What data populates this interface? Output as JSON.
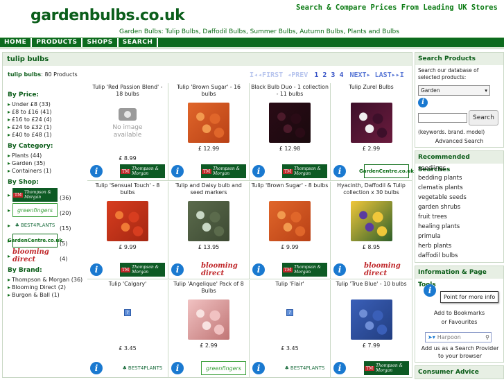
{
  "site": {
    "title": "gardenbulbs.co.uk",
    "tagline": "Search & Compare Prices From Leading UK Stores",
    "sublinks": "Garden Bulbs: Tulip Bulbs, Daffodil Bulbs, Summer Bulbs, Autumn Bulbs, Plants and Bulbs"
  },
  "nav": [
    "HOME",
    "PRODUCTS",
    "SHOPS",
    "SEARCH"
  ],
  "main": {
    "title": "tulip bulbs",
    "count_bold": "tulip bulbs",
    "count_rest": ": 80 Products"
  },
  "pager": {
    "first": "I◂◂FIRST",
    "prev": "◂PREV",
    "pages": [
      "1",
      "2",
      "3",
      "4"
    ],
    "next": "NEXT▸",
    "last": "LAST▸▸I"
  },
  "filters": {
    "price_title": "By Price:",
    "price": [
      "Under £8 (33)",
      "£8 to £16 (41)",
      "£16 to £24 (4)",
      "£24 to £32 (1)",
      "£40 to £48 (1)"
    ],
    "category_title": "By Category:",
    "category": [
      "Plants (44)",
      "Garden (35)",
      "Containers (1)"
    ],
    "shop_title": "By Shop:",
    "shops": [
      {
        "logo": "Thompson & Morgan",
        "count": "(36)"
      },
      {
        "logo": "greenfingers",
        "count": "(20)"
      },
      {
        "logo": "BEST4PLANTS",
        "count": "(15)"
      },
      {
        "logo": "GardenCentre.co.uk",
        "count": "(5)"
      },
      {
        "logo": "blooming direct",
        "count": "(4)"
      }
    ],
    "brand_title": "By Brand:",
    "brand": [
      "Thompson & Morgan (36)",
      "Blooming Direct (2)",
      "Burgon & Ball (1)"
    ]
  },
  "products": [
    {
      "name": "Tulip 'Red Passion Blend' - 18 bulbs",
      "price": "£ 8.99",
      "img": "none",
      "shop": "tm"
    },
    {
      "name": "Tulip 'Brown Sugar' - 16 bulbs",
      "price": "£ 12.99",
      "img": "orange",
      "shop": "tm"
    },
    {
      "name": "Black Bulb Duo - 1 collection - 11 bulbs",
      "price": "£ 12.98",
      "img": "dark",
      "shop": "tm"
    },
    {
      "name": "Tulip Zurel Bulbs",
      "price": "£ 2.99",
      "img": "purple",
      "shop": "gc"
    },
    {
      "name": "Tulip 'Sensual Touch' - 8 bulbs",
      "price": "£ 9.99",
      "img": "redorange",
      "shop": "tm"
    },
    {
      "name": "Tulip and Daisy bulb and seed markers",
      "price": "£ 13.95",
      "img": "markers",
      "shop": "bd"
    },
    {
      "name": "Tulip 'Brown Sugar' - 8 bulbs",
      "price": "£ 9.99",
      "img": "orange",
      "shop": "tm"
    },
    {
      "name": "Hyacinth, Daffodil & Tulip collection x 30 bulbs",
      "price": "£ 8.95",
      "img": "mixed",
      "shop": "bd"
    },
    {
      "name": "Tulip 'Calgary'",
      "price": "£ 3.45",
      "img": "q",
      "shop": "b4"
    },
    {
      "name": "Tulip 'Angelique' Pack of 8 Bulbs",
      "price": "£ 2.99",
      "img": "pink",
      "shop": "gf"
    },
    {
      "name": "Tulip 'Flair'",
      "price": "£ 3.45",
      "img": "q",
      "shop": "b4"
    },
    {
      "name": "Tulip 'True Blue' - 10 bulbs",
      "price": "£ 7.99",
      "img": "blue",
      "shop": "tm"
    }
  ],
  "noimage": {
    "line1": "No image",
    "line2": "available"
  },
  "logos": {
    "tm": "Thompson & Morgan",
    "gf": "greenfingers",
    "b4": "BEST4PLANTS",
    "gc": "GardenCentre.co.uk",
    "bd": "blooming direct"
  },
  "sidebar": {
    "search_title": "Search Products",
    "search_desc": "Search our database of selected products:",
    "search_select": "Garden",
    "search_button": "Search",
    "search_hint": "(keywords. brand. model)",
    "advanced": "Advanced Search",
    "rec_title": "Recommended Searches",
    "rec": [
      "seedlings",
      "bedding plants",
      "clematis plants",
      "vegetable seeds",
      "garden shrubs",
      "fruit trees",
      "healing plants",
      "primula",
      "herb plants",
      "daffodil bulbs"
    ],
    "info_title": "Information & Page Tools",
    "tooltip": "Point for more info",
    "bookmark": "Add to Bookmarks",
    "favourites": "or Favourites",
    "provider_placeholder": "Harpoon",
    "provider_text": "Add us as a Search Provider to your browser",
    "consumer_title": "Consumer Advice"
  }
}
